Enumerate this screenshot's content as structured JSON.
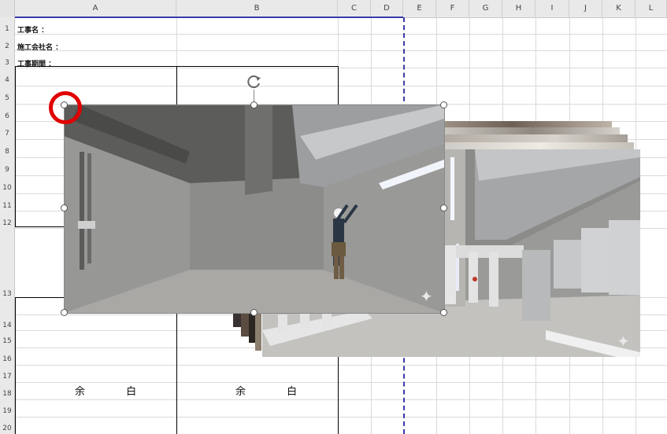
{
  "columns": [
    "A",
    "B",
    "C",
    "D",
    "E",
    "F",
    "G",
    "H",
    "I",
    "J",
    "K",
    "L"
  ],
  "rows": [
    "1",
    "2",
    "3",
    "4",
    "5",
    "6",
    "7",
    "8",
    "9",
    "10",
    "11",
    "12",
    "13",
    "14",
    "15",
    "16",
    "17",
    "18",
    "19",
    "20"
  ],
  "labels": {
    "project_name": "工事名 ：",
    "contractor": "施工会社名 ：",
    "period": "工事期間 ："
  },
  "blank_cells": {
    "left": "余 白",
    "right": "余 白"
  },
  "icons": {
    "rotate": "rotate-handle-icon",
    "sparkle": "ai-sparkle-icon"
  },
  "colors": {
    "page_break": "#3a3aa8",
    "highlight_ring": "#e00000"
  }
}
